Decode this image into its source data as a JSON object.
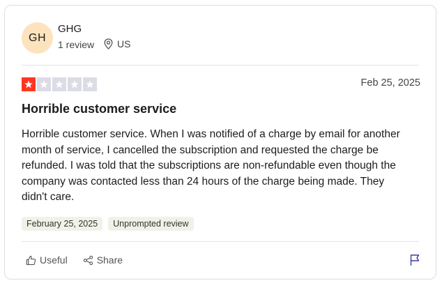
{
  "reviewer": {
    "initials": "GH",
    "name": "GHG",
    "review_count": "1 review",
    "country": "US"
  },
  "review": {
    "rating": 1,
    "max_rating": 5,
    "date": "Feb 25, 2025",
    "title": "Horrible customer service",
    "body": "Horrible customer service. When I was notified of a charge by email for another month of service, I cancelled the subscription and requested the charge be refunded. I was told that the subscriptions are non-refundable even though the company was contacted less than 24 hours of the charge being made. They didn't care.",
    "tags": [
      "February 25, 2025",
      "Unprompted review"
    ]
  },
  "actions": {
    "useful_label": "Useful",
    "share_label": "Share"
  },
  "colors": {
    "star_filled": "#ff3722",
    "star_empty": "#dcdce6",
    "avatar_bg": "#fde3bd"
  }
}
